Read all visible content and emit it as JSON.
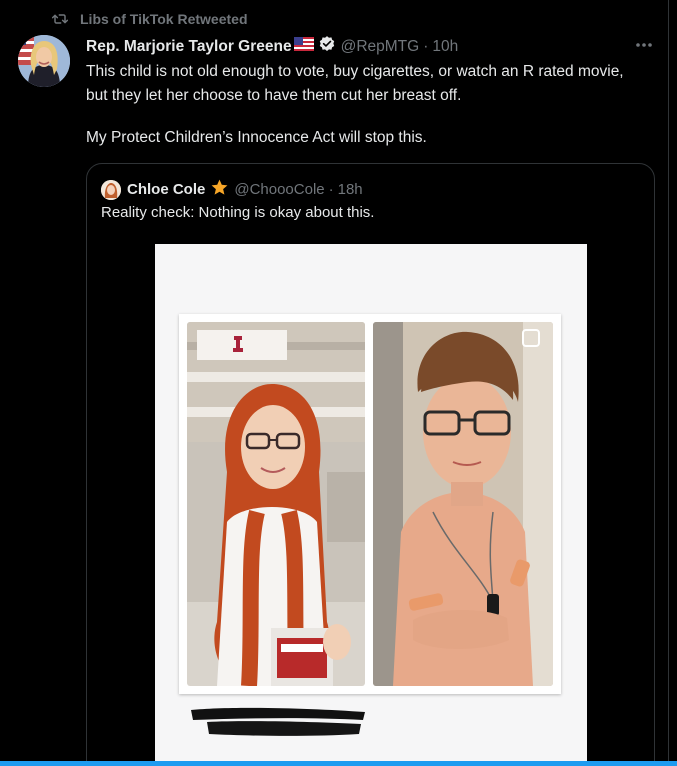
{
  "retweet": {
    "label": "Libs of TikTok Retweeted",
    "icon": "retweet-icon"
  },
  "tweet": {
    "author_name": "Rep. Marjorie Taylor Greene",
    "flag": "us-flag-icon",
    "verified": "verified-badge-icon",
    "handle": "@RepMTG",
    "separator": "·",
    "time": "10h",
    "text_line1": "This child is not old enough to vote, buy cigarettes, or watch an R rated movie, but they let her choose to have them cut her breast off.",
    "text_line2": "My Protect Children’s Innocence Act will stop this."
  },
  "quote": {
    "author_name": "Chloe Cole",
    "badge": "star-icon",
    "handle": "@ChoooCole",
    "separator": "·",
    "time": "18h",
    "text": "Reality check: Nothing is okay about this."
  },
  "colors": {
    "background": "#000000",
    "primary_text": "#e7e9ea",
    "secondary_text": "#71767b",
    "border": "#2f3336",
    "accent": "#1d9bf0",
    "star": "#f7a628"
  }
}
